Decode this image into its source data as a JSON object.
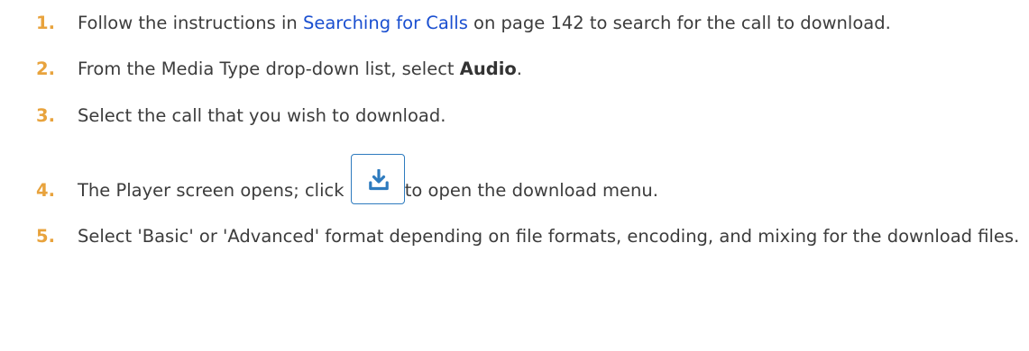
{
  "steps": [
    {
      "number": "1.",
      "text_before": "Follow the instructions in ",
      "link": "Searching for Calls",
      "text_after": " on page 142 to search for the call to download."
    },
    {
      "number": "2.",
      "text_before": "From the Media Type drop-down list, select ",
      "bold": "Audio",
      "text_after": "."
    },
    {
      "number": "3.",
      "text": "Select the call that you wish to download."
    },
    {
      "number": "4.",
      "text_before": "The Player screen opens; click ",
      "icon": "download-icon",
      "text_after": "to open the download menu."
    },
    {
      "number": "5.",
      "text": "Select 'Basic' or 'Advanced' format depending on file formats, encoding, and mixing for the download files."
    }
  ],
  "colors": {
    "step_number": "#e8a33d",
    "link": "#1a4fd0",
    "icon": "#2e7bbf",
    "body_text": "#3c3c3c"
  }
}
